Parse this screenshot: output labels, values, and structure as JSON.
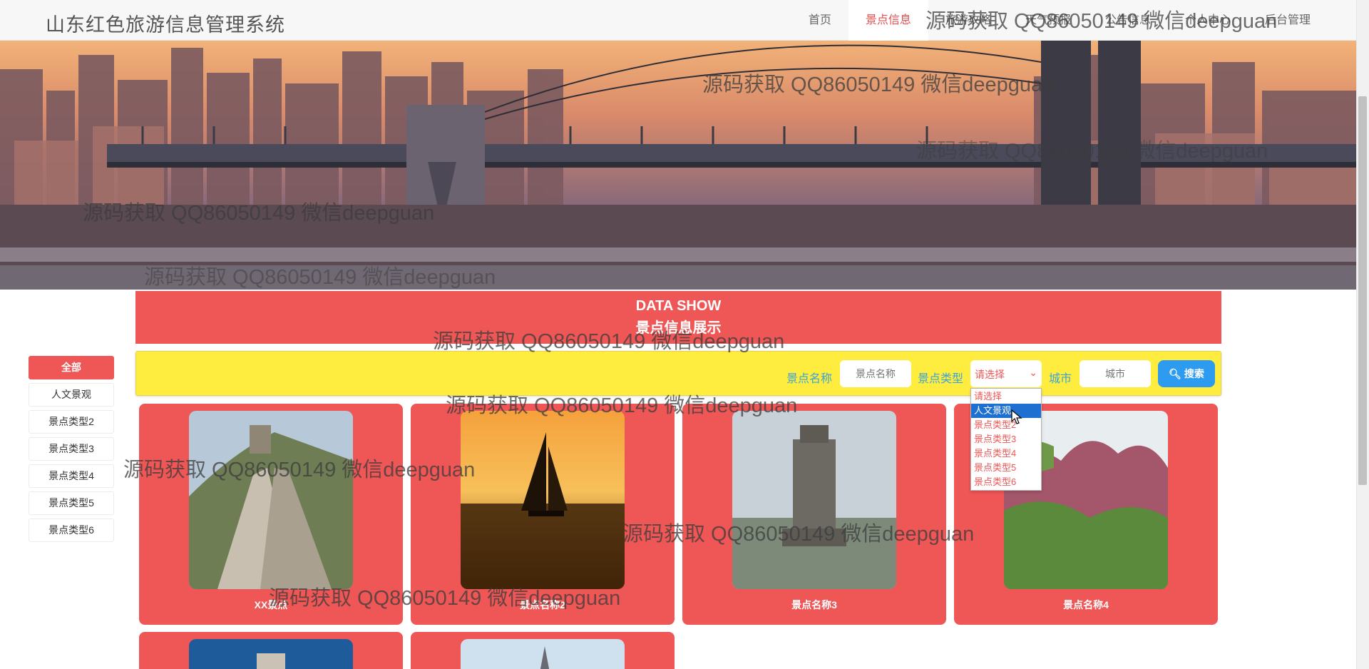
{
  "header": {
    "brand": "山东红色旅游信息管理系统",
    "nav": [
      {
        "label": "首页",
        "active": false
      },
      {
        "label": "景点信息",
        "active": true
      },
      {
        "label": "旅游攻略",
        "active": false
      },
      {
        "label": "天气预报",
        "active": false
      },
      {
        "label": "公告信息",
        "active": false
      },
      {
        "label": "个人中心",
        "active": false
      },
      {
        "label": "后台管理",
        "active": false
      }
    ]
  },
  "banner": {
    "slide_count": 3,
    "active_slide": 1
  },
  "show": {
    "title_en": "DATA SHOW",
    "title_cn": "景点信息展示"
  },
  "categories": [
    {
      "label": "全部",
      "active": true
    },
    {
      "label": "人文景观",
      "active": false
    },
    {
      "label": "景点类型2",
      "active": false
    },
    {
      "label": "景点类型3",
      "active": false
    },
    {
      "label": "景点类型4",
      "active": false
    },
    {
      "label": "景点类型5",
      "active": false
    },
    {
      "label": "景点类型6",
      "active": false
    }
  ],
  "search": {
    "name_label": "景点名称",
    "name_placeholder": "景点名称",
    "type_label": "景点类型",
    "type_value": "请选择",
    "city_label": "城市",
    "city_placeholder": "城市",
    "button_label": "搜索"
  },
  "type_options": [
    "请选择",
    "人文景观",
    "景点类型2",
    "景点类型3",
    "景点类型4",
    "景点类型5",
    "景点类型6"
  ],
  "highlighted_option": "人文景观",
  "cards": [
    {
      "title": "XX景点",
      "image": "great-wall"
    },
    {
      "title": "景点名称2",
      "image": "sailboat-sunset"
    },
    {
      "title": "景点名称3",
      "image": "monument-city"
    },
    {
      "title": "景点名称4",
      "image": "red-cliffs"
    },
    {
      "title": "",
      "image": "tower-blue-sky"
    },
    {
      "title": "",
      "image": "spire-clouds"
    }
  ],
  "watermark": "源码获取 QQ86050149 微信deepguan",
  "colors": {
    "accent": "#ef5656",
    "search_bg": "#feed3e",
    "label_blue": "#3da3d6",
    "button_blue": "#2d9bf0",
    "progress_active": "#3db24b"
  }
}
